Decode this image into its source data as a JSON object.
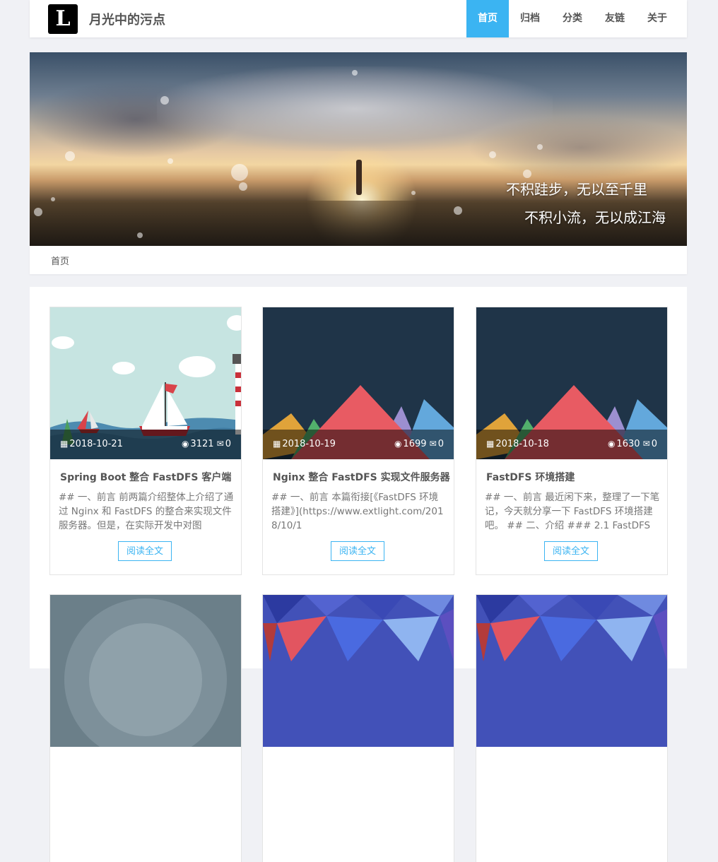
{
  "nav": {
    "logo_letter": "L",
    "site_title": "月光中的污点",
    "menu": [
      {
        "label": "首页",
        "active": true
      },
      {
        "label": "归档",
        "active": false
      },
      {
        "label": "分类",
        "active": false
      },
      {
        "label": "友链",
        "active": false
      },
      {
        "label": "关于",
        "active": false
      }
    ]
  },
  "banner": {
    "quote_line1": "不积跬步，无以至千里",
    "quote_line2": "不积小流，无以成江海"
  },
  "breadcrumb": {
    "home": "首页"
  },
  "colors": {
    "accent": "#3bb4f2",
    "page_bg": "#f0f1f5"
  },
  "icons": {
    "date": "calendar-icon",
    "views": "eye-icon",
    "comments": "comment-icon"
  },
  "posts": [
    {
      "date": "2018-10-21",
      "views": "3121",
      "comments": "0",
      "title": "Spring Boot 整合 FastDFS 客户端",
      "excerpt": "## 一、前言 前两篇介绍整体上介绍了通过 Nginx 和 FastDFS 的整合来实现文件服务器。但是，在实际开发中对图",
      "read_label": "阅读全文"
    },
    {
      "date": "2018-10-19",
      "views": "1699",
      "comments": "0",
      "title": "Nginx 整合 FastDFS 实现文件服务器",
      "excerpt": "## 一、前言 本篇衔接[《FastDFS 环境搭建》](https://www.extlight.com/2018/10/1",
      "read_label": "阅读全文"
    },
    {
      "date": "2018-10-18",
      "views": "1630",
      "comments": "0",
      "title": "FastDFS 环境搭建",
      "excerpt": "## 一、前言 最近闲下来，整理了一下笔记，今天就分享一下 FastDFS 环境搭建吧。 ## 二、介绍 ### 2.1 FastDFS",
      "read_label": "阅读全文"
    }
  ]
}
